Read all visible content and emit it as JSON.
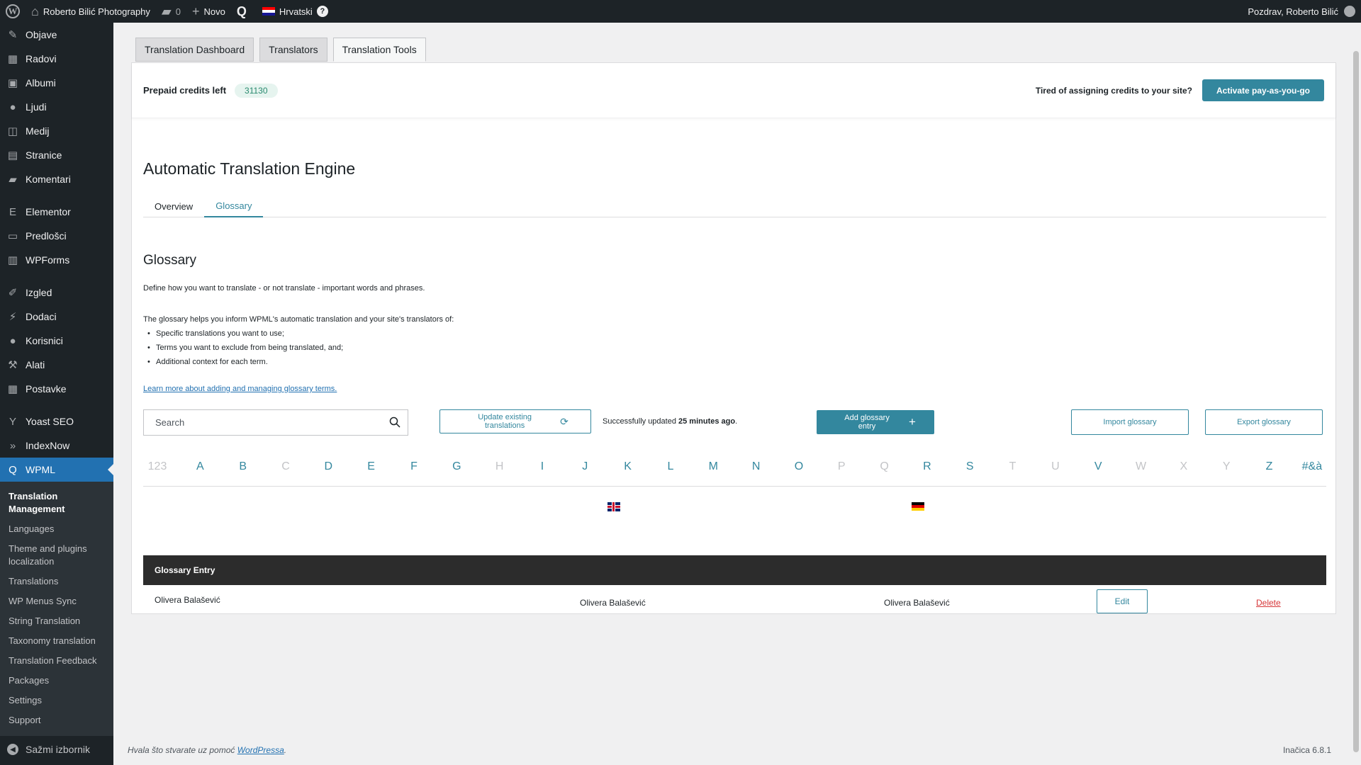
{
  "adminbar": {
    "site_name": "Roberto Bilić Photography",
    "comments_count": "0",
    "new_label": "Novo",
    "language": "Hrvatski",
    "greeting": "Pozdrav, Roberto Bilić"
  },
  "menu": {
    "items_top": [
      {
        "label": "Objave",
        "icon": "pin-icon"
      },
      {
        "label": "Radovi",
        "icon": "grid-icon"
      },
      {
        "label": "Albumi",
        "icon": "album-icon"
      },
      {
        "label": "Ljudi",
        "icon": "person-icon"
      },
      {
        "label": "Medij",
        "icon": "media-icon"
      },
      {
        "label": "Stranice",
        "icon": "page-icon"
      },
      {
        "label": "Komentari",
        "icon": "comment-icon"
      }
    ],
    "items_mid": [
      {
        "label": "Elementor",
        "icon": "elementor-icon"
      },
      {
        "label": "Predlošci",
        "icon": "folder-icon"
      },
      {
        "label": "WPForms",
        "icon": "forms-icon"
      }
    ],
    "items_low": [
      {
        "label": "Izgled",
        "icon": "brush-icon"
      },
      {
        "label": "Dodaci",
        "icon": "plugin-icon"
      },
      {
        "label": "Korisnici",
        "icon": "users-icon"
      },
      {
        "label": "Alati",
        "icon": "wrench-icon"
      },
      {
        "label": "Postavke",
        "icon": "settings-icon"
      }
    ],
    "items_plugins": [
      {
        "label": "Yoast SEO",
        "icon": "yoast-icon"
      },
      {
        "label": "IndexNow",
        "icon": "indexnow-icon"
      }
    ],
    "current": {
      "label": "WPML",
      "icon": "wpml-icon"
    },
    "submenu": [
      "Translation Management",
      "Languages",
      "Theme and plugins localization",
      "Translations",
      "WP Menus Sync",
      "String Translation",
      "Taxonomy translation",
      "Translation Feedback",
      "Packages",
      "Settings",
      "Support"
    ],
    "collapse_label": "Sažmi izbornik"
  },
  "tabs": [
    "Translation Dashboard",
    "Translators",
    "Translation Tools"
  ],
  "credits": {
    "label": "Prepaid credits left",
    "value": "31130",
    "tired_text": "Tired of assigning credits to your site?",
    "activate_label": "Activate pay-as-you-go"
  },
  "engine": {
    "title": "Automatic Translation Engine",
    "subtabs": [
      "Overview",
      "Glossary"
    ]
  },
  "glossary": {
    "title": "Glossary",
    "description": "Define how you want to translate - or not translate - important words and phrases.",
    "help_intro": "The glossary helps you inform WPML's automatic translation and your site's translators of:",
    "help_items": [
      "Specific translations you want to use;",
      "Terms you want to exclude from being translated, and;",
      "Additional context for each term."
    ],
    "learn_more": "Learn more about adding and managing glossary terms.",
    "search_placeholder": "Search",
    "update_label": "Update existing translations",
    "status_prefix": "Successfully updated ",
    "status_time": "25 minutes ago",
    "status_suffix": ".",
    "add_label": "Add glossary entry",
    "import_label": "Import glossary",
    "export_label": "Export glossary",
    "alphabet": [
      {
        "l": "123",
        "on": false
      },
      {
        "l": "A",
        "on": true
      },
      {
        "l": "B",
        "on": true
      },
      {
        "l": "C",
        "on": false
      },
      {
        "l": "D",
        "on": true
      },
      {
        "l": "E",
        "on": true
      },
      {
        "l": "F",
        "on": true
      },
      {
        "l": "G",
        "on": true
      },
      {
        "l": "H",
        "on": false
      },
      {
        "l": "I",
        "on": true
      },
      {
        "l": "J",
        "on": true
      },
      {
        "l": "K",
        "on": true
      },
      {
        "l": "L",
        "on": true
      },
      {
        "l": "M",
        "on": true
      },
      {
        "l": "N",
        "on": true
      },
      {
        "l": "O",
        "on": true
      },
      {
        "l": "P",
        "on": false
      },
      {
        "l": "Q",
        "on": false
      },
      {
        "l": "R",
        "on": true
      },
      {
        "l": "S",
        "on": true
      },
      {
        "l": "T",
        "on": false
      },
      {
        "l": "U",
        "on": false
      },
      {
        "l": "V",
        "on": true
      },
      {
        "l": "W",
        "on": false
      },
      {
        "l": "X",
        "on": false
      },
      {
        "l": "Y",
        "on": false
      },
      {
        "l": "Z",
        "on": true
      },
      {
        "l": "#&à",
        "on": true
      }
    ],
    "table_header": "Glossary Entry",
    "rows": [
      {
        "entry": "Olivera Balašević",
        "source": "Olivera Balašević",
        "translation": "Olivera Balašević",
        "edit": "Edit",
        "delete": "Delete"
      }
    ]
  },
  "footer": {
    "thanks_prefix": "Hvala što stvarate uz pomoć ",
    "thanks_link": "WordPressa",
    "thanks_suffix": ".",
    "version": "Inačica 6.8.1"
  },
  "colors": {
    "accent": "#33879e",
    "wp_blue": "#2271b1",
    "admin_dark": "#1d2327",
    "delete_red": "#d63638"
  }
}
